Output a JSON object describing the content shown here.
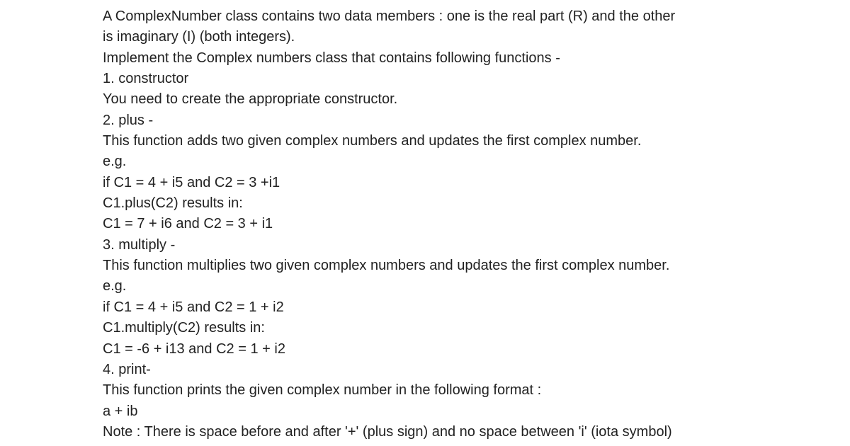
{
  "document": {
    "lines": [
      "A ComplexNumber class contains two data members : one is the real part (R) and the other",
      "is imaginary (I) (both integers).",
      "Implement the Complex numbers class that contains following functions -",
      "1. constructor",
      "You need to create the appropriate constructor.",
      "2. plus -",
      "This function adds two given complex numbers and updates the first complex number.",
      "e.g.",
      "if C1 = 4 + i5 and C2 = 3 +i1",
      "C1.plus(C2) results in:",
      "C1 = 7 + i6 and C2 = 3 + i1",
      "3. multiply -",
      "This function multiplies two given complex numbers and updates the first complex number.",
      "e.g.",
      "if C1 = 4 + i5 and C2 = 1 + i2",
      "C1.multiply(C2) results in:",
      "C1 = -6 + i13 and C2 = 1 + i2",
      "4. print-",
      "This function prints the given complex number in the following format :",
      "a + ib",
      "Note : There is space before and after '+' (plus sign) and no space between 'i' (iota symbol)"
    ]
  }
}
